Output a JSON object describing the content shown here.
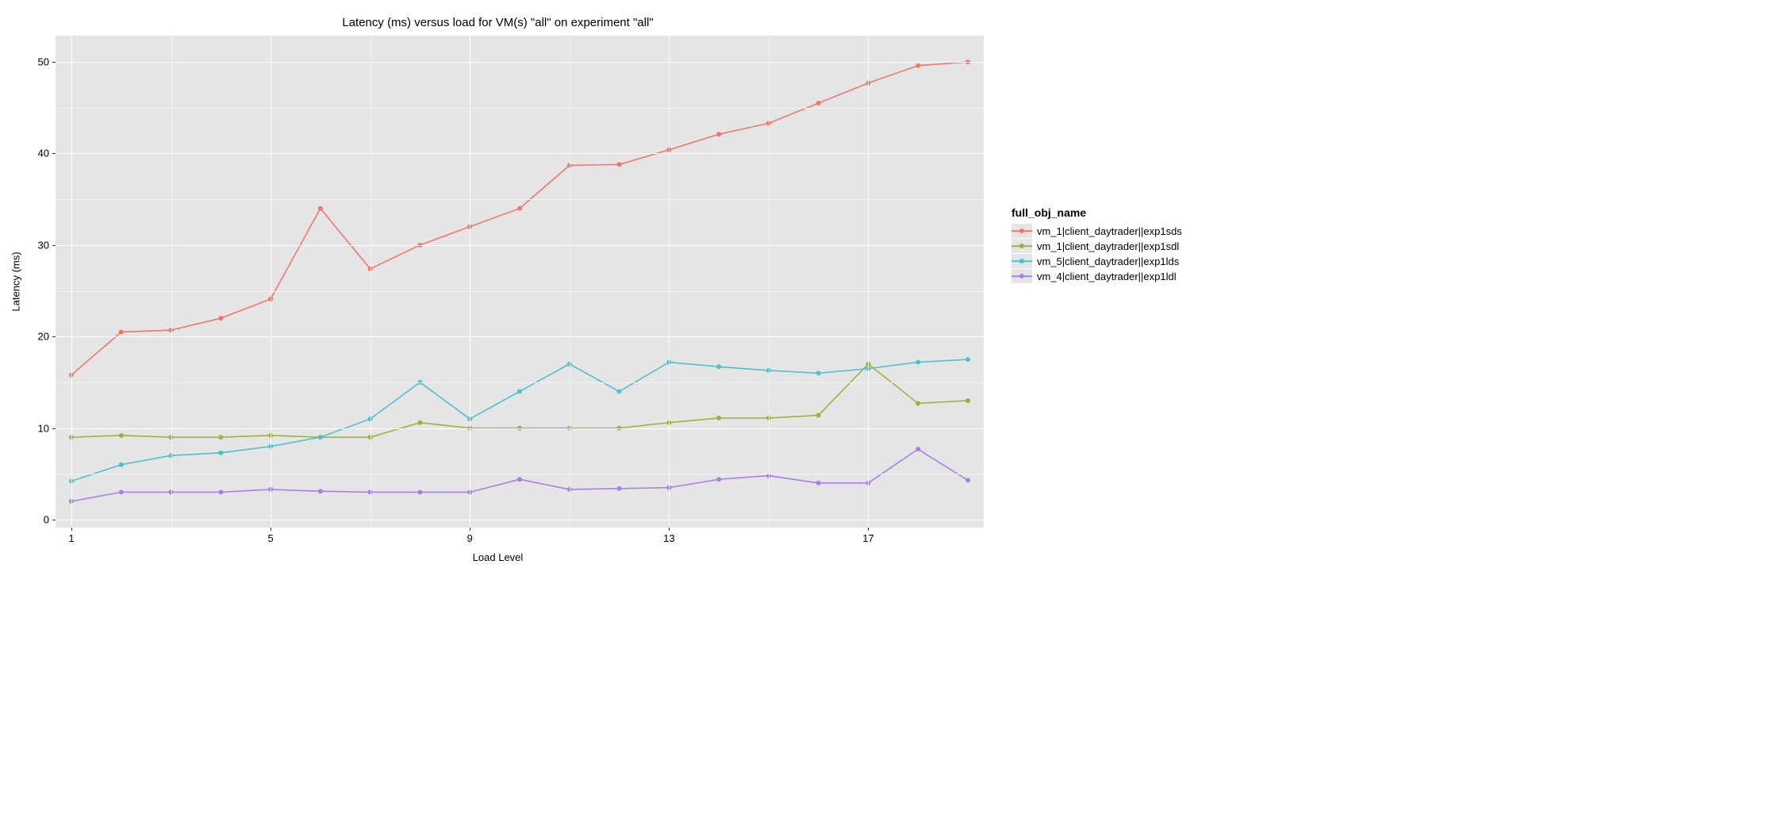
{
  "chart_data": {
    "type": "line",
    "title": "Latency (ms) versus load for VM(s) \"all\" on experiment \"all\"",
    "xlabel": "Load Level",
    "ylabel": "Latency (ms)",
    "xlim": [
      1,
      19
    ],
    "ylim": [
      0,
      52
    ],
    "x_ticks": [
      1,
      5,
      9,
      13,
      17
    ],
    "y_ticks": [
      0,
      10,
      20,
      30,
      40,
      50
    ],
    "legend_title": "full_obj_name",
    "legend_position": "right",
    "categories": [
      1,
      2,
      3,
      4,
      5,
      6,
      7,
      8,
      9,
      10,
      11,
      12,
      13,
      14,
      15,
      16,
      17,
      18,
      19
    ],
    "series": [
      {
        "name": "vm_1|client_daytrader||exp1sds",
        "color": "#f1766d",
        "values": [
          15.8,
          20.5,
          20.7,
          22.0,
          24.1,
          34.0,
          27.4,
          30.0,
          32.0,
          34.0,
          38.7,
          38.8,
          40.4,
          42.1,
          43.3,
          45.5,
          47.7,
          49.6,
          50.0
        ]
      },
      {
        "name": "vm_1|client_daytrader||exp1sdl",
        "color": "#9cb33a",
        "values": [
          9.0,
          9.2,
          9.0,
          9.0,
          9.2,
          9.0,
          9.0,
          10.6,
          10.0,
          10.0,
          10.0,
          10.0,
          10.6,
          11.1,
          11.1,
          11.4,
          17.0,
          12.7,
          13.0
        ]
      },
      {
        "name": "vm_5|client_daytrader||exp1lds",
        "color": "#4bc2cf",
        "values": [
          4.2,
          6.0,
          7.0,
          7.3,
          8.0,
          9.0,
          11.0,
          15.0,
          11.0,
          14.0,
          17.0,
          14.0,
          17.2,
          16.7,
          16.3,
          16.0,
          16.5,
          17.2,
          17.5
        ]
      },
      {
        "name": "vm_4|client_daytrader||exp1ldl",
        "color": "#a680e6",
        "values": [
          2.0,
          3.0,
          3.0,
          3.0,
          3.3,
          3.1,
          3.0,
          3.0,
          3.0,
          4.4,
          3.3,
          3.4,
          3.5,
          4.4,
          4.8,
          4.0,
          4.0,
          7.7,
          4.3
        ]
      }
    ]
  }
}
